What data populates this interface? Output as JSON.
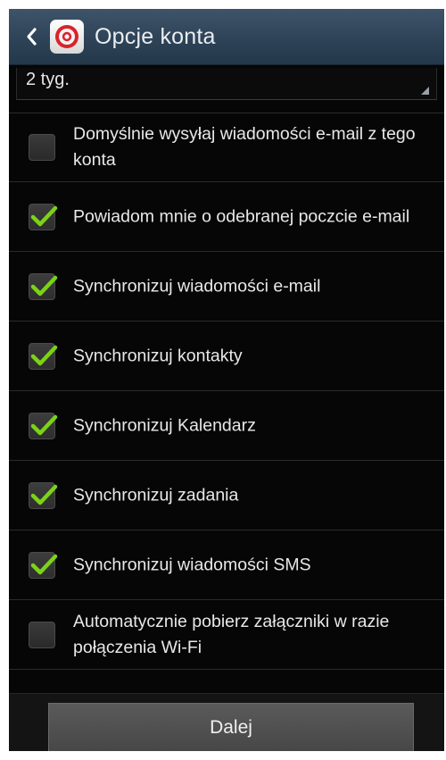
{
  "header": {
    "title": "Opcje konta",
    "back_icon": "chevron-left-icon",
    "app_icon": "email-app-icon"
  },
  "sync_period": {
    "value": "2 tyg."
  },
  "options": [
    {
      "label": "Domyślnie wysyłaj wiadomości e-mail z tego konta",
      "checked": false
    },
    {
      "label": "Powiadom mnie o odebranej poczcie e-mail",
      "checked": true
    },
    {
      "label": "Synchronizuj wiadomości e-mail",
      "checked": true
    },
    {
      "label": "Synchronizuj kontakty",
      "checked": true
    },
    {
      "label": "Synchronizuj Kalendarz",
      "checked": true
    },
    {
      "label": "Synchronizuj zadania",
      "checked": true
    },
    {
      "label": "Synchronizuj wiadomości SMS",
      "checked": true
    },
    {
      "label": "Automatycznie pobierz załączniki w razie połączenia Wi-Fi",
      "checked": false
    }
  ],
  "footer": {
    "next_label": "Dalej"
  },
  "colors": {
    "accent_check": "#7bd316",
    "header_bg": "#2e4357",
    "background": "#060606"
  }
}
